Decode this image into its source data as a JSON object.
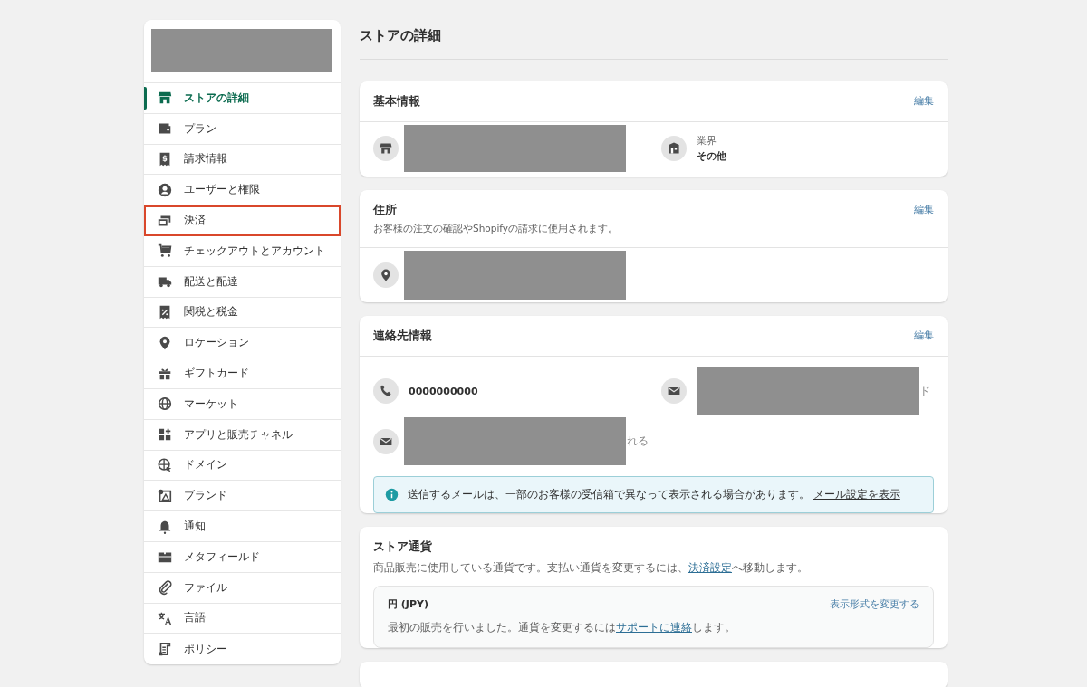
{
  "sidebar": {
    "items": [
      {
        "label": "ストアの詳細",
        "selected": true,
        "highlighted": false
      },
      {
        "label": "プラン",
        "selected": false,
        "highlighted": false
      },
      {
        "label": "請求情報",
        "selected": false,
        "highlighted": false
      },
      {
        "label": "ユーザーと権限",
        "selected": false,
        "highlighted": false
      },
      {
        "label": "決済",
        "selected": false,
        "highlighted": true
      },
      {
        "label": "チェックアウトとアカウント",
        "selected": false,
        "highlighted": false
      },
      {
        "label": "配送と配達",
        "selected": false,
        "highlighted": false
      },
      {
        "label": "関税と税金",
        "selected": false,
        "highlighted": false
      },
      {
        "label": "ロケーション",
        "selected": false,
        "highlighted": false
      },
      {
        "label": "ギフトカード",
        "selected": false,
        "highlighted": false
      },
      {
        "label": "マーケット",
        "selected": false,
        "highlighted": false
      },
      {
        "label": "アプリと販売チャネル",
        "selected": false,
        "highlighted": false
      },
      {
        "label": "ドメイン",
        "selected": false,
        "highlighted": false
      },
      {
        "label": "ブランド",
        "selected": false,
        "highlighted": false
      },
      {
        "label": "通知",
        "selected": false,
        "highlighted": false
      },
      {
        "label": "メタフィールド",
        "selected": false,
        "highlighted": false
      },
      {
        "label": "ファイル",
        "selected": false,
        "highlighted": false
      },
      {
        "label": "言語",
        "selected": false,
        "highlighted": false
      },
      {
        "label": "ポリシー",
        "selected": false,
        "highlighted": false
      }
    ]
  },
  "page_title": "ストアの詳細",
  "basic_info": {
    "title": "基本情報",
    "edit": "編集",
    "industry_label": "業界",
    "industry_value": "その他"
  },
  "address": {
    "title": "住所",
    "subtitle": "お客様の注文の確認やShopifyの請求に使用されます。",
    "edit": "編集"
  },
  "contact": {
    "title": "連絡先情報",
    "edit": "編集",
    "phone": "0000000000",
    "email_fragment": "ド",
    "sender_fragment": "れる",
    "notice": {
      "text": "送信するメールは、一部のお客様の受信箱で異なって表示される場合があります。",
      "link": "メール設定を表示"
    }
  },
  "currency": {
    "title": "ストア通貨",
    "description_before": "商品販売に使用している通貨です。支払い通貨を変更するには、",
    "description_link": "決済設定",
    "description_after": "へ移動します。",
    "currency": "円 (JPY)",
    "change_format": "表示形式を変更する",
    "note_before": "最初の販売を行いました。通貨を変更するには",
    "note_link": "サポートに連絡",
    "note_after": "します。"
  }
}
